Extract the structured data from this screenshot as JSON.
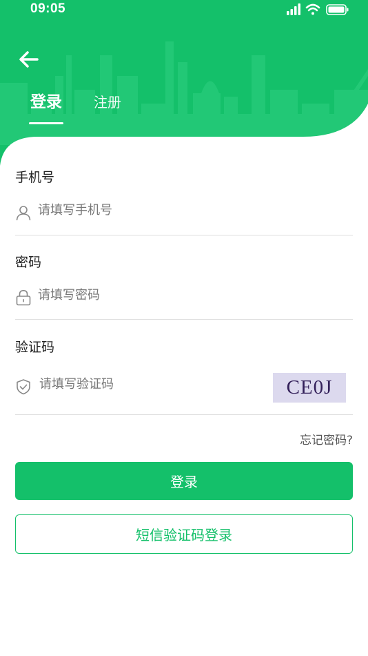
{
  "status_bar": {
    "time": "09:05"
  },
  "tabs": {
    "login": "登录",
    "register": "注册"
  },
  "phone": {
    "label": "手机号",
    "placeholder": "请填写手机号"
  },
  "password": {
    "label": "密码",
    "placeholder": "请填写密码"
  },
  "captcha": {
    "label": "验证码",
    "placeholder": "请填写验证码",
    "code": "CE0J"
  },
  "forgot_password": "忘记密码?",
  "login_button": "登录",
  "sms_login_button": "短信验证码登录",
  "colors": {
    "brand_green": "#14c06a",
    "captcha_bg": "#dcd9ee"
  },
  "icons": [
    "back-arrow-icon",
    "user-icon",
    "lock-icon",
    "shield-check-icon",
    "signal-icon",
    "wifi-icon",
    "battery-icon"
  ]
}
